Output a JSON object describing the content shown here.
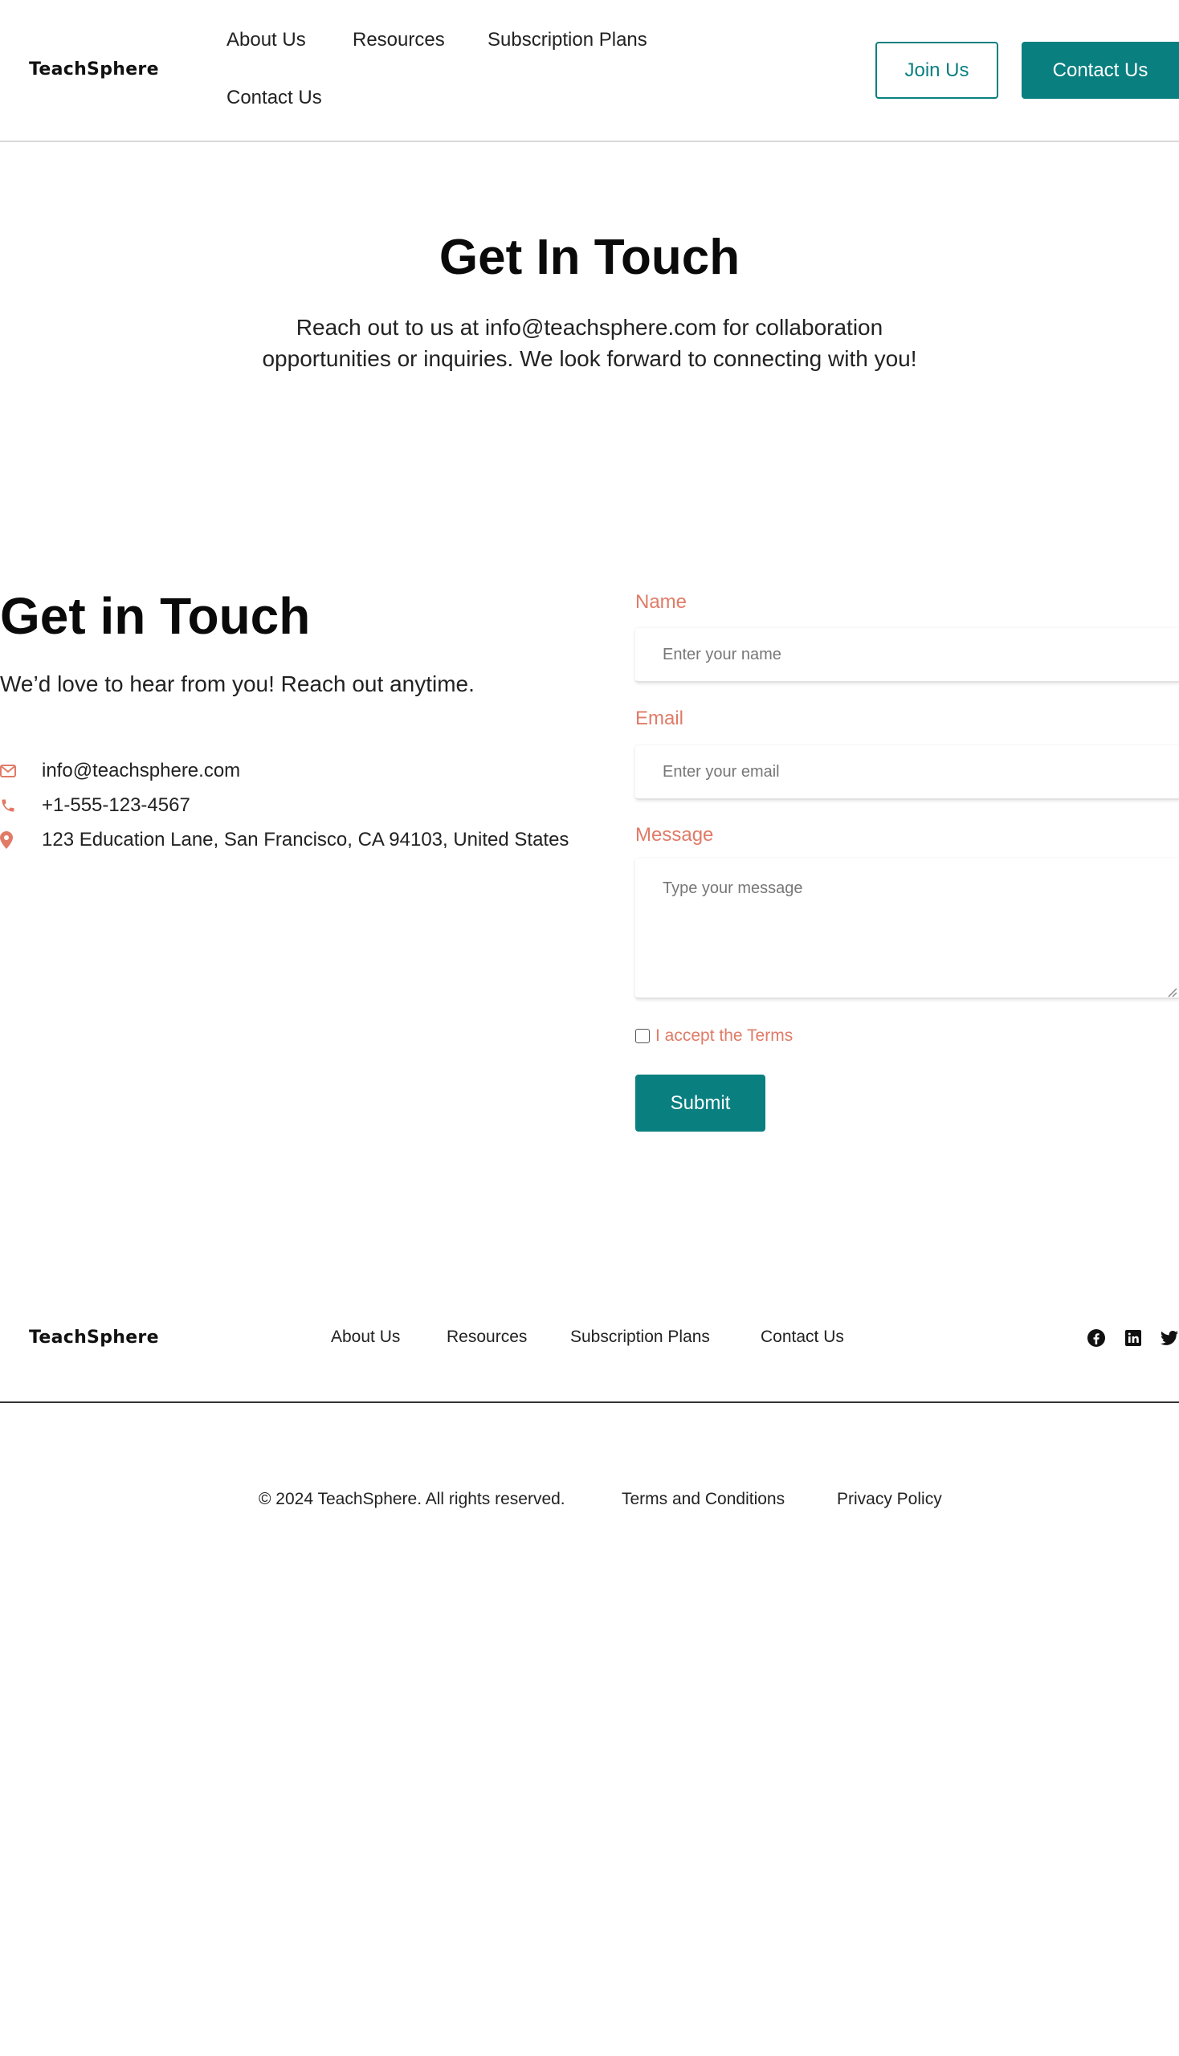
{
  "header": {
    "logo": "TeachSphere",
    "nav": [
      "About Us",
      "Resources",
      "Subscription Plans",
      "Contact Us"
    ],
    "join_label": "Join Us",
    "contact_label": "Contact Us"
  },
  "hero": {
    "title": "Get In Touch",
    "text": "Reach out to us at info@teachsphere.com for collaboration opportunities or inquiries. We look forward to connecting with you!"
  },
  "contact": {
    "title": "Get in Touch",
    "subtitle": "We’d love to hear from you! Reach out anytime.",
    "email": "info@teachsphere.com",
    "phone": "+1-555-123-4567",
    "address": "123 Education Lane, San Francisco, CA 94103, United States",
    "icons": [
      "envelope-icon",
      "phone-icon",
      "map-pin-icon"
    ],
    "icon_color": "#e07b67"
  },
  "form": {
    "name_label": "Name",
    "name_placeholder": "Enter your name",
    "email_label": "Email",
    "email_placeholder": "Enter your email",
    "message_label": "Message",
    "message_placeholder": "Type your message",
    "terms_label": "I accept the Terms",
    "terms_checked": false,
    "submit_label": "Submit"
  },
  "footer": {
    "logo": "TeachSphere",
    "nav": [
      "About Us",
      "Resources",
      "Subscription Plans",
      "Contact Us"
    ],
    "social": [
      "facebook-icon",
      "linkedin-icon",
      "twitter-icon"
    ],
    "copyright": "© 2024 TeachSphere. All rights reserved.",
    "terms": "Terms and Conditions",
    "privacy": "Privacy Policy"
  },
  "colors": {
    "accent": "#0a7f80",
    "label": "#e07b67",
    "text": "#222222"
  }
}
